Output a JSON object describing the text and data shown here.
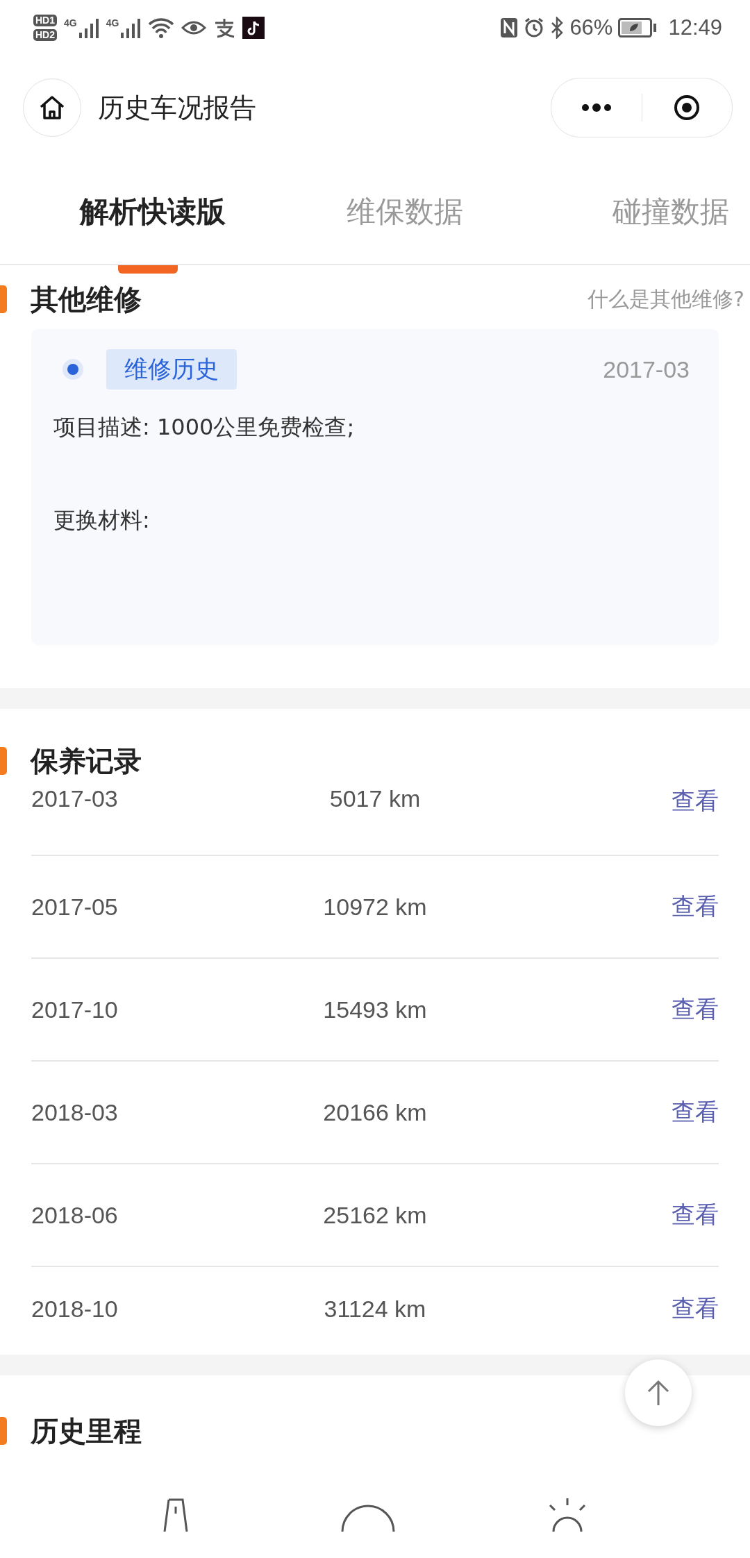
{
  "status_bar": {
    "sims": [
      {
        "badge": "HD",
        "slot": "1",
        "network": "4G"
      },
      {
        "badge": "HD",
        "slot": "2",
        "network": "4G"
      }
    ],
    "battery": "66%",
    "time": "12:49"
  },
  "title_bar": {
    "title": "历史车况报告"
  },
  "tabs": [
    {
      "label": "解析快读版",
      "selected": true
    },
    {
      "label": "维保数据",
      "selected": false
    },
    {
      "label": "碰撞数据",
      "selected": false
    }
  ],
  "other_repair": {
    "heading": "其他维修",
    "help_link": "什么是其他维修?",
    "record": {
      "tag": "维修历史",
      "date": "2017-03",
      "description": "项目描述: 1000公里免费检查;",
      "materials": "更换材料:"
    }
  },
  "maintenance": {
    "heading": "保养记录",
    "rows": [
      {
        "date": "2017-03",
        "mileage": "5017 km",
        "action": "查看"
      },
      {
        "date": "2017-05",
        "mileage": "10972 km",
        "action": "查看"
      },
      {
        "date": "2017-10",
        "mileage": "15493 km",
        "action": "查看"
      },
      {
        "date": "2018-03",
        "mileage": "20166 km",
        "action": "查看"
      },
      {
        "date": "2018-06",
        "mileage": "25162 km",
        "action": "查看"
      },
      {
        "date": "2018-10",
        "mileage": "31124 km",
        "action": "查看"
      }
    ]
  },
  "mileage_history": {
    "heading": "历史里程"
  }
}
